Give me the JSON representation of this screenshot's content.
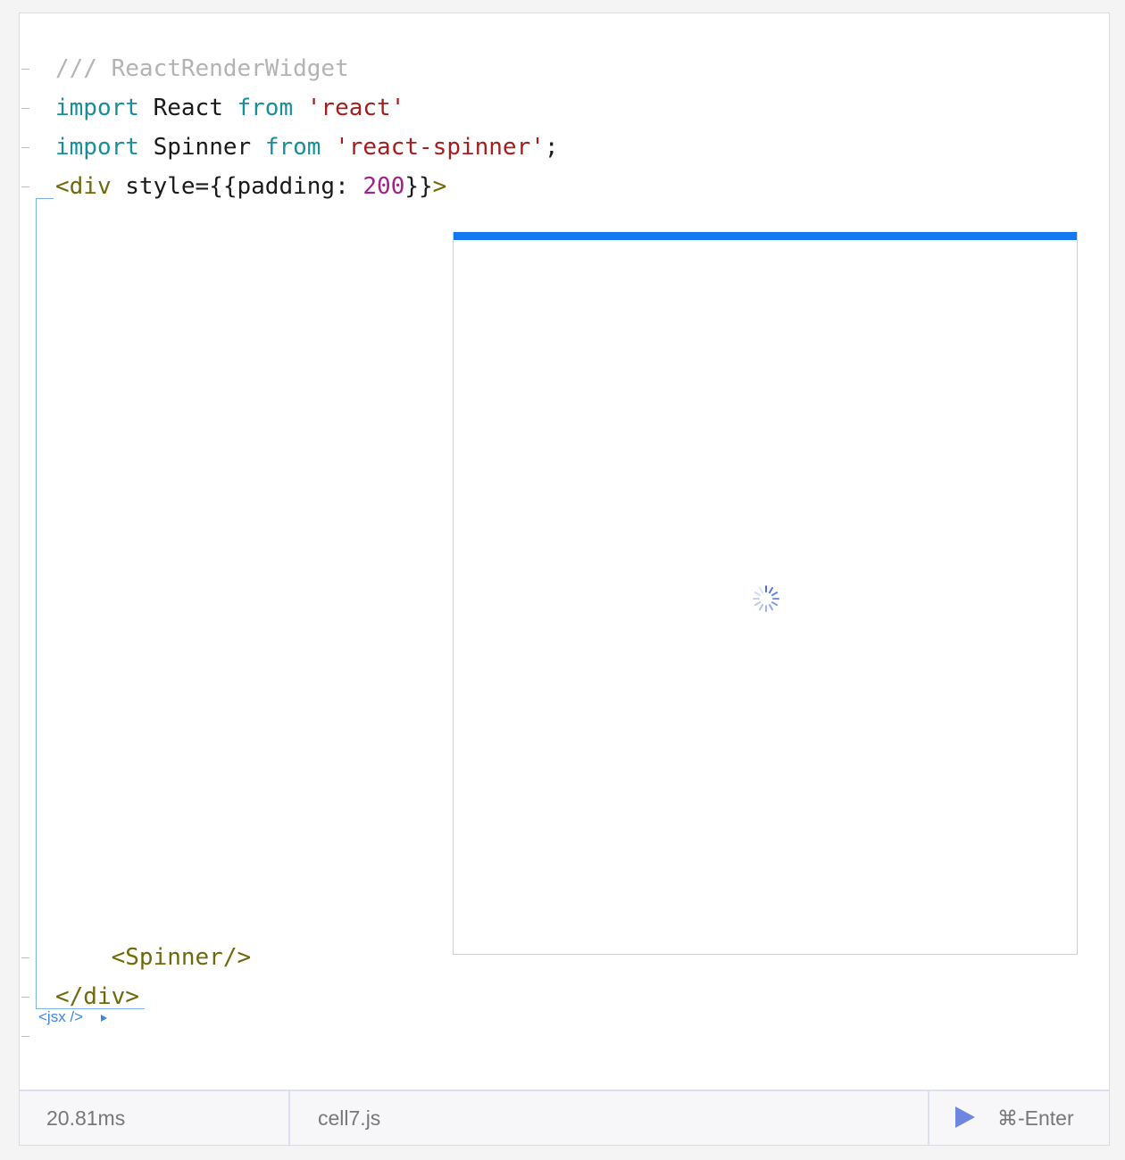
{
  "code": {
    "lines": [
      [
        {
          "t": "/// ReactRenderWidget",
          "c": "comment"
        }
      ],
      [
        {
          "t": "import",
          "c": "kw"
        },
        {
          "t": " React ",
          "c": "plain"
        },
        {
          "t": "from",
          "c": "kw"
        },
        {
          "t": " ",
          "c": "plain"
        },
        {
          "t": "'react'",
          "c": "str"
        }
      ],
      [
        {
          "t": "import",
          "c": "kw"
        },
        {
          "t": " Spinner ",
          "c": "plain"
        },
        {
          "t": "from",
          "c": "kw"
        },
        {
          "t": " ",
          "c": "plain"
        },
        {
          "t": "'react-spinner'",
          "c": "str"
        },
        {
          "t": ";",
          "c": "plain"
        }
      ],
      [
        {
          "t": "<div",
          "c": "tag"
        },
        {
          "t": " style={{padding: ",
          "c": "plain"
        },
        {
          "t": "200",
          "c": "num"
        },
        {
          "t": "}}",
          "c": "plain"
        },
        {
          "t": ">",
          "c": "tag"
        }
      ],
      [
        {
          "t": "    <Spinner/>",
          "c": "tag"
        }
      ],
      [
        {
          "t": "</div>",
          "c": "tag"
        }
      ]
    ]
  },
  "jsx_label": "<jsx />",
  "footer": {
    "time": "20.81ms",
    "filename": "cell7.js",
    "shortcut": "⌘-Enter"
  },
  "colors": {
    "accent": "#1478f0",
    "run_button": "#6f86e0",
    "spinner": "#4a6fd8"
  },
  "icons": {
    "run": "play-triangle-icon",
    "expand": "caret-right-icon",
    "spinner": "loading-spinner-icon"
  }
}
